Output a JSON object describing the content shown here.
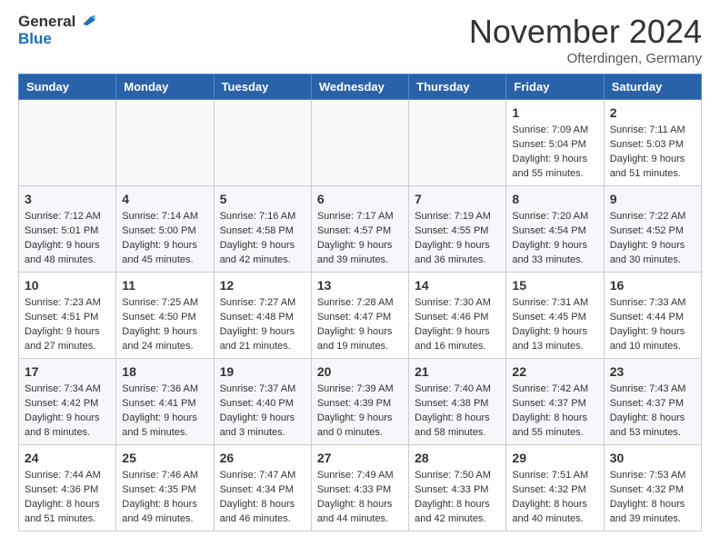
{
  "header": {
    "logo_general": "General",
    "logo_blue": "Blue",
    "month_title": "November 2024",
    "location": "Ofterdingen, Germany"
  },
  "calendar": {
    "days_of_week": [
      "Sunday",
      "Monday",
      "Tuesday",
      "Wednesday",
      "Thursday",
      "Friday",
      "Saturday"
    ],
    "weeks": [
      [
        {
          "day": "",
          "info": ""
        },
        {
          "day": "",
          "info": ""
        },
        {
          "day": "",
          "info": ""
        },
        {
          "day": "",
          "info": ""
        },
        {
          "day": "",
          "info": ""
        },
        {
          "day": "1",
          "info": "Sunrise: 7:09 AM\nSunset: 5:04 PM\nDaylight: 9 hours and 55 minutes."
        },
        {
          "day": "2",
          "info": "Sunrise: 7:11 AM\nSunset: 5:03 PM\nDaylight: 9 hours and 51 minutes."
        }
      ],
      [
        {
          "day": "3",
          "info": "Sunrise: 7:12 AM\nSunset: 5:01 PM\nDaylight: 9 hours and 48 minutes."
        },
        {
          "day": "4",
          "info": "Sunrise: 7:14 AM\nSunset: 5:00 PM\nDaylight: 9 hours and 45 minutes."
        },
        {
          "day": "5",
          "info": "Sunrise: 7:16 AM\nSunset: 4:58 PM\nDaylight: 9 hours and 42 minutes."
        },
        {
          "day": "6",
          "info": "Sunrise: 7:17 AM\nSunset: 4:57 PM\nDaylight: 9 hours and 39 minutes."
        },
        {
          "day": "7",
          "info": "Sunrise: 7:19 AM\nSunset: 4:55 PM\nDaylight: 9 hours and 36 minutes."
        },
        {
          "day": "8",
          "info": "Sunrise: 7:20 AM\nSunset: 4:54 PM\nDaylight: 9 hours and 33 minutes."
        },
        {
          "day": "9",
          "info": "Sunrise: 7:22 AM\nSunset: 4:52 PM\nDaylight: 9 hours and 30 minutes."
        }
      ],
      [
        {
          "day": "10",
          "info": "Sunrise: 7:23 AM\nSunset: 4:51 PM\nDaylight: 9 hours and 27 minutes."
        },
        {
          "day": "11",
          "info": "Sunrise: 7:25 AM\nSunset: 4:50 PM\nDaylight: 9 hours and 24 minutes."
        },
        {
          "day": "12",
          "info": "Sunrise: 7:27 AM\nSunset: 4:48 PM\nDaylight: 9 hours and 21 minutes."
        },
        {
          "day": "13",
          "info": "Sunrise: 7:28 AM\nSunset: 4:47 PM\nDaylight: 9 hours and 19 minutes."
        },
        {
          "day": "14",
          "info": "Sunrise: 7:30 AM\nSunset: 4:46 PM\nDaylight: 9 hours and 16 minutes."
        },
        {
          "day": "15",
          "info": "Sunrise: 7:31 AM\nSunset: 4:45 PM\nDaylight: 9 hours and 13 minutes."
        },
        {
          "day": "16",
          "info": "Sunrise: 7:33 AM\nSunset: 4:44 PM\nDaylight: 9 hours and 10 minutes."
        }
      ],
      [
        {
          "day": "17",
          "info": "Sunrise: 7:34 AM\nSunset: 4:42 PM\nDaylight: 9 hours and 8 minutes."
        },
        {
          "day": "18",
          "info": "Sunrise: 7:36 AM\nSunset: 4:41 PM\nDaylight: 9 hours and 5 minutes."
        },
        {
          "day": "19",
          "info": "Sunrise: 7:37 AM\nSunset: 4:40 PM\nDaylight: 9 hours and 3 minutes."
        },
        {
          "day": "20",
          "info": "Sunrise: 7:39 AM\nSunset: 4:39 PM\nDaylight: 9 hours and 0 minutes."
        },
        {
          "day": "21",
          "info": "Sunrise: 7:40 AM\nSunset: 4:38 PM\nDaylight: 8 hours and 58 minutes."
        },
        {
          "day": "22",
          "info": "Sunrise: 7:42 AM\nSunset: 4:37 PM\nDaylight: 8 hours and 55 minutes."
        },
        {
          "day": "23",
          "info": "Sunrise: 7:43 AM\nSunset: 4:37 PM\nDaylight: 8 hours and 53 minutes."
        }
      ],
      [
        {
          "day": "24",
          "info": "Sunrise: 7:44 AM\nSunset: 4:36 PM\nDaylight: 8 hours and 51 minutes."
        },
        {
          "day": "25",
          "info": "Sunrise: 7:46 AM\nSunset: 4:35 PM\nDaylight: 8 hours and 49 minutes."
        },
        {
          "day": "26",
          "info": "Sunrise: 7:47 AM\nSunset: 4:34 PM\nDaylight: 8 hours and 46 minutes."
        },
        {
          "day": "27",
          "info": "Sunrise: 7:49 AM\nSunset: 4:33 PM\nDaylight: 8 hours and 44 minutes."
        },
        {
          "day": "28",
          "info": "Sunrise: 7:50 AM\nSunset: 4:33 PM\nDaylight: 8 hours and 42 minutes."
        },
        {
          "day": "29",
          "info": "Sunrise: 7:51 AM\nSunset: 4:32 PM\nDaylight: 8 hours and 40 minutes."
        },
        {
          "day": "30",
          "info": "Sunrise: 7:53 AM\nSunset: 4:32 PM\nDaylight: 8 hours and 39 minutes."
        }
      ]
    ]
  }
}
